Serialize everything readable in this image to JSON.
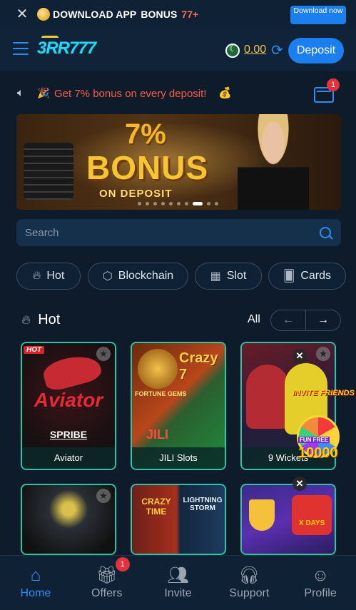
{
  "download_bar": {
    "close_icon": "close-icon",
    "text": "DOWNLOAD APP",
    "bonus_text": "BONUS",
    "bonus_amount": "77+",
    "button_label": "Download now"
  },
  "header": {
    "logo": "3RR777",
    "balance": "0.00",
    "deposit_label": "Deposit"
  },
  "notice": {
    "text": "Get 7% bonus on every deposit!",
    "mail_badge": "1"
  },
  "banner": {
    "percent": "7%",
    "headline": "BONUS",
    "subline": "ON DEPOSIT"
  },
  "search": {
    "placeholder": "Search"
  },
  "categories": [
    {
      "label": "Hot",
      "icon": "flame-icon"
    },
    {
      "label": "Blockchain",
      "icon": "cube-icon"
    },
    {
      "label": "Slot",
      "icon": "slot-machine-icon"
    },
    {
      "label": "Cards",
      "icon": "cards-icon"
    }
  ],
  "section": {
    "title": "Hot",
    "all_label": "All"
  },
  "games": [
    {
      "name": "Aviator",
      "tag": "HOT",
      "brand": "Aviator",
      "provider": "SPRIBE"
    },
    {
      "name": "JILI Slots",
      "art_text_1": "FORTUNE GEMS",
      "art_text_2": "Crazy 7",
      "art_text_3": "JILI"
    },
    {
      "name": "9 Wickets",
      "overlay": "INVITE FRIENDS"
    },
    {
      "name": ""
    },
    {
      "name": "",
      "art_text_1": "CRAZY TIME",
      "art_text_2": "LIGHTNING STORM"
    },
    {
      "name": "",
      "overlay": "X DAYS"
    }
  ],
  "promo_wheel": {
    "label": "FUN FREE",
    "amount": "10000"
  },
  "bottom_nav": [
    {
      "label": "Home",
      "icon": "home-icon",
      "active": true
    },
    {
      "label": "Offers",
      "icon": "gift-icon",
      "badge": "1"
    },
    {
      "label": "Invite",
      "icon": "invite-icon"
    },
    {
      "label": "Support",
      "icon": "headset-icon"
    },
    {
      "label": "Profile",
      "icon": "profile-icon"
    }
  ],
  "colors": {
    "background": "#0d1b2a",
    "accent": "#1c7ff0",
    "notice_text": "#ff5b45",
    "balance": "#f2c94c",
    "card_border": "#27c7a7",
    "badge": "#e5313c"
  }
}
